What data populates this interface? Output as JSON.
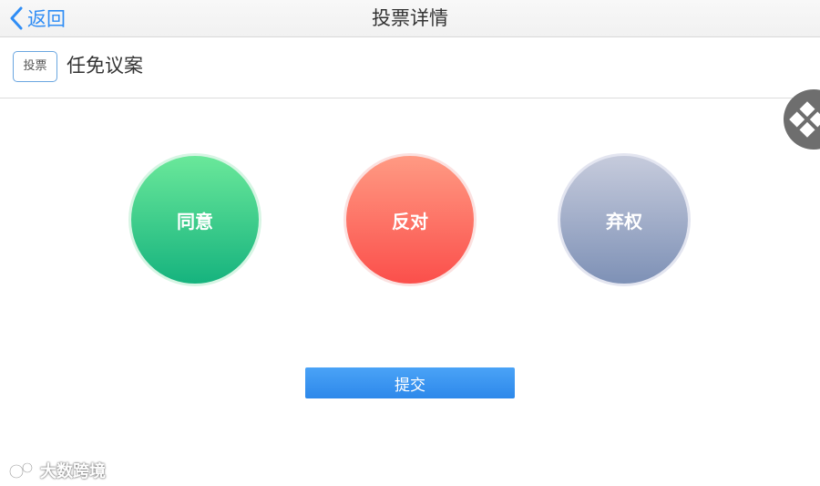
{
  "navbar": {
    "back_label": "返回",
    "title": "投票详情"
  },
  "motion": {
    "type_badge": "投票",
    "title": "任免议案"
  },
  "options": [
    {
      "label": "同意",
      "color_top": "#6ae89a",
      "color_bottom": "#16b37e"
    },
    {
      "label": "反对",
      "color_top": "#ff9a83",
      "color_bottom": "#fb4f4b"
    },
    {
      "label": "弃权",
      "color_top": "#c6cbdc",
      "color_bottom": "#7e91b6"
    }
  ],
  "submit_label": "提交",
  "watermark": "大数跨境",
  "colors": {
    "accent": "#2f8df5",
    "submit": "#3b95f2"
  }
}
